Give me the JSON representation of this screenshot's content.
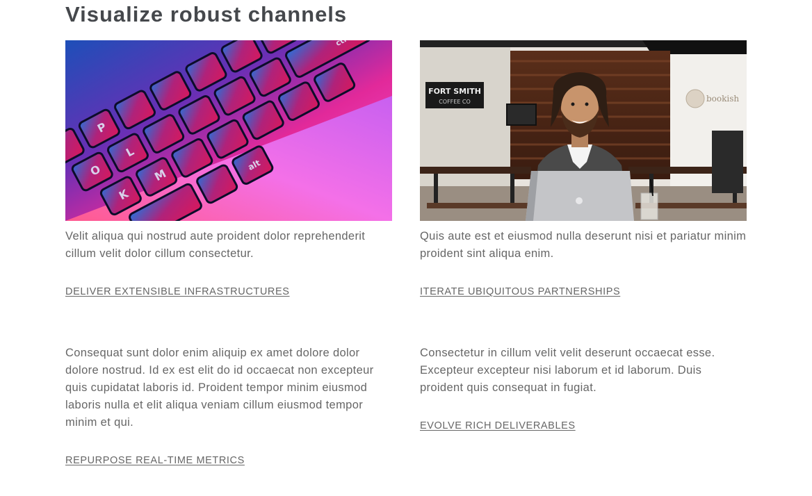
{
  "section": {
    "title": "Visualize robust channels"
  },
  "cards": [
    {
      "image": "keyboard-photo",
      "text": "Velit aliqua qui nostrud aute proident dolor reprehenderit cillum velit dolor cillum consectetur.",
      "link": "DELIVER EXTENSIBLE INFRASTRUCTURES"
    },
    {
      "image": "man-with-laptop-photo",
      "text": "Quis aute est et eiusmod nulla deserunt nisi et pariatur minim proident sint aliqua enim.",
      "link": "ITERATE UBIQUITOUS PARTNERSHIPS"
    },
    {
      "text": "Consequat sunt dolor enim aliquip ex amet dolore dolor dolore nostrud. Id ex est elit do id occaecat non excepteur quis cupidatat laboris id. Proident tempor minim eiusmod laboris nulla et elit aliqua veniam cillum eiusmod tempor minim et qui.",
      "link": "REPURPOSE REAL-TIME METRICS"
    },
    {
      "text": "Consectetur in cillum velit velit deserunt occaecat esse. Excepteur excepteur nisi laborum et id laborum. Duis proident quis consequat in fugiat.",
      "link": "EVOLVE RICH DELIVERABLES"
    }
  ],
  "photo_text": {
    "sign_line1": "FORT SMITH",
    "sign_line2": "COFFEE CO",
    "wall_logo": "bookish"
  }
}
